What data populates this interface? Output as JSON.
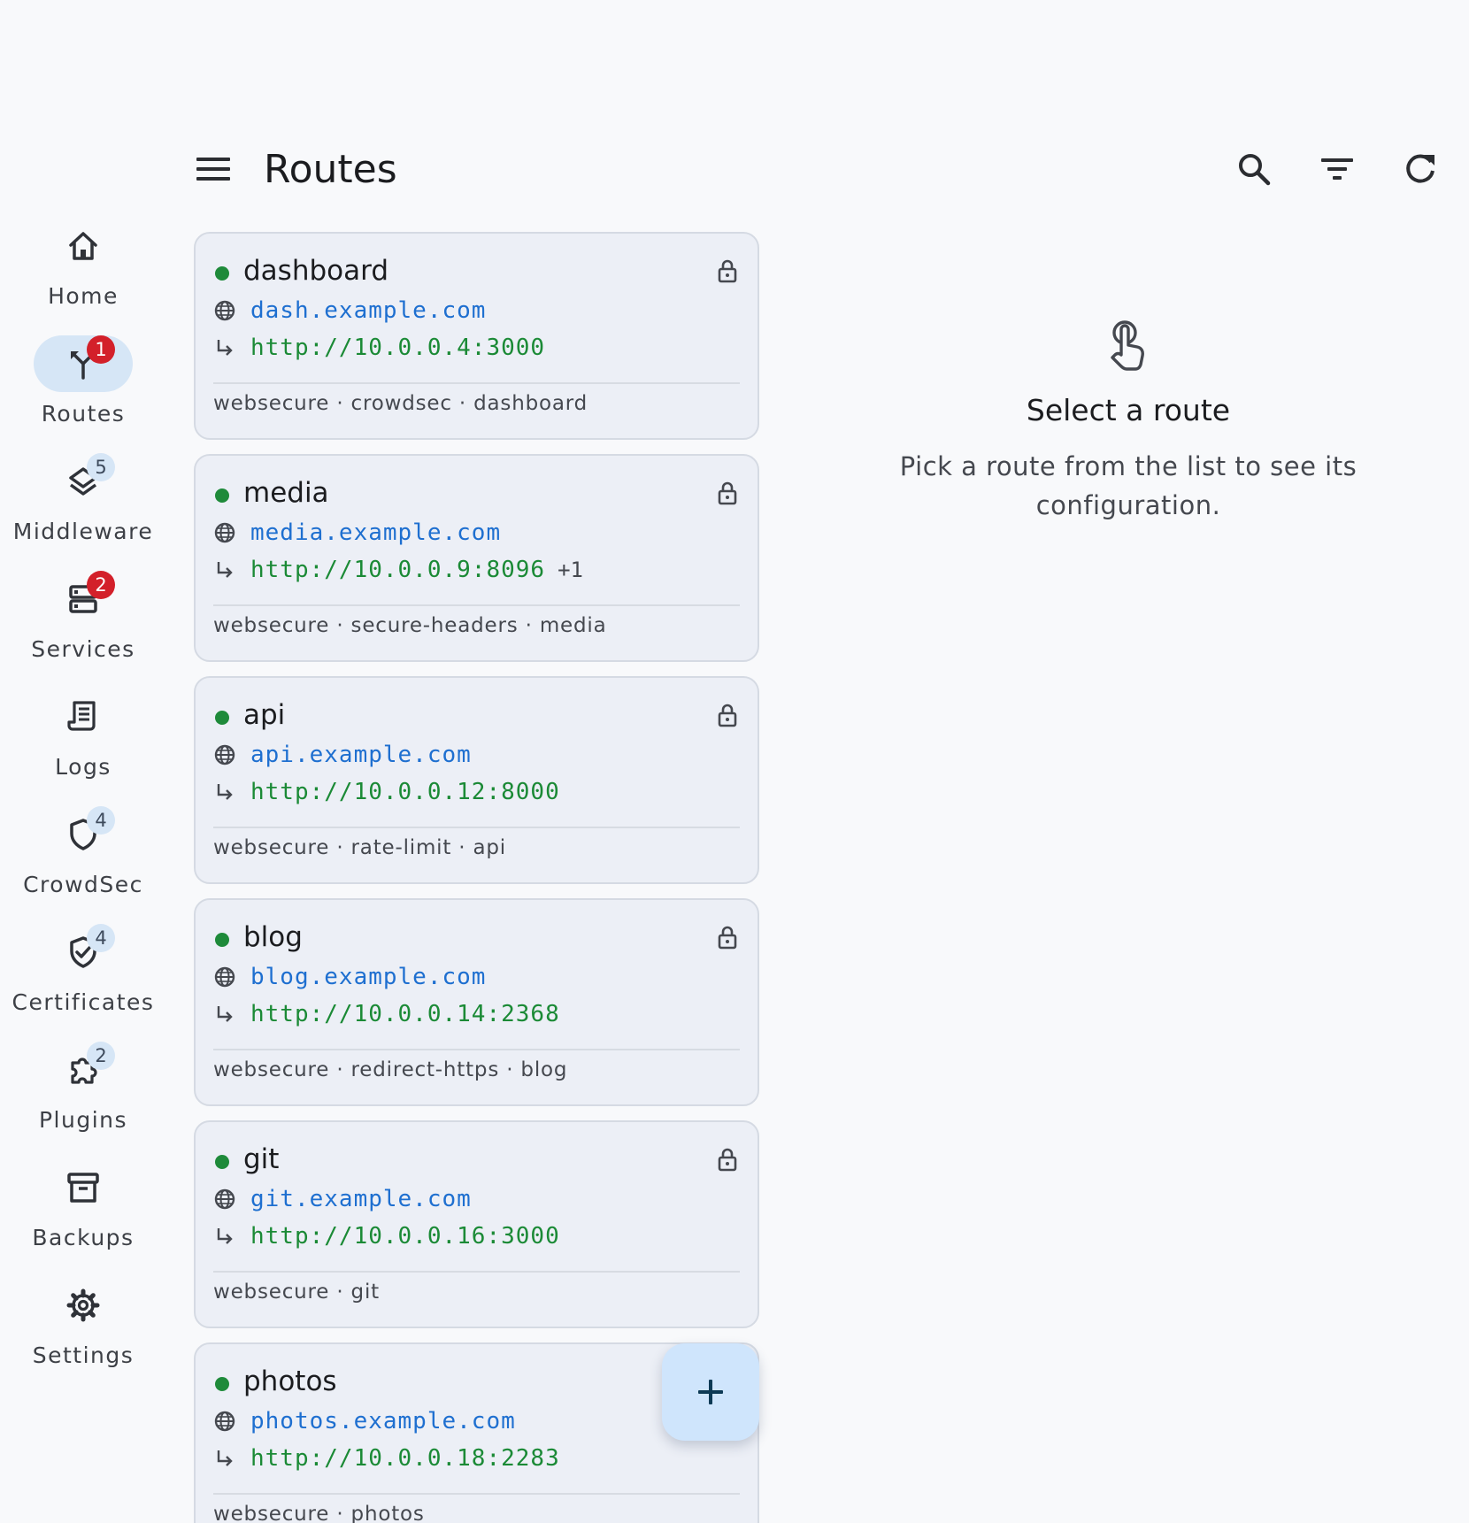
{
  "colors": {
    "background": "#f8f9fb",
    "card": "#eceff6",
    "host": "#1e6fd0",
    "target": "#1b8a36",
    "status_ok": "#1e8a3a",
    "badge_alert": "#d3202a",
    "nav_active": "#d6e6f6",
    "fab": "#cfe5fc"
  },
  "topbar": {
    "title": "Routes",
    "menu_icon": "menu-icon",
    "actions": [
      "search-icon",
      "filter-icon",
      "refresh-icon"
    ]
  },
  "nav": {
    "items": [
      {
        "label": "Home",
        "icon": "home-icon",
        "badge": "",
        "active": false
      },
      {
        "label": "Routes",
        "icon": "routes-icon",
        "badge": "1",
        "active": true
      },
      {
        "label": "Middleware",
        "icon": "layers-icon",
        "badge": "5",
        "active": false
      },
      {
        "label": "Services",
        "icon": "server-icon",
        "badge": "2",
        "active": false
      },
      {
        "label": "Logs",
        "icon": "logs-icon",
        "badge": "",
        "active": false
      },
      {
        "label": "CrowdSec",
        "icon": "shield-icon",
        "badge": "4",
        "active": false
      },
      {
        "label": "Certificates",
        "icon": "certificate-icon",
        "badge": "4",
        "active": false
      },
      {
        "label": "Plugins",
        "icon": "plugin-icon",
        "badge": "2",
        "active": false
      },
      {
        "label": "Backups",
        "icon": "archive-icon",
        "badge": "",
        "active": false
      },
      {
        "label": "Settings",
        "icon": "gear-icon",
        "badge": "",
        "active": false
      }
    ]
  },
  "routes": [
    {
      "name": "dashboard",
      "host": "dash.example.com",
      "target": "http://10.0.0.4:3000",
      "extra": "",
      "chips": "websecure · crowdsec · dashboard",
      "locked": true
    },
    {
      "name": "media",
      "host": "media.example.com",
      "target": "http://10.0.0.9:8096",
      "extra": "+1",
      "chips": "websecure · secure-headers · media",
      "locked": true
    },
    {
      "name": "api",
      "host": "api.example.com",
      "target": "http://10.0.0.12:8000",
      "extra": "",
      "chips": "websecure · rate-limit · api",
      "locked": true
    },
    {
      "name": "blog",
      "host": "blog.example.com",
      "target": "http://10.0.0.14:2368",
      "extra": "",
      "chips": "websecure · redirect-https · blog",
      "locked": true
    },
    {
      "name": "git",
      "host": "git.example.com",
      "target": "http://10.0.0.16:3000",
      "extra": "",
      "chips": "websecure · git",
      "locked": true
    },
    {
      "name": "photos",
      "host": "photos.example.com",
      "target": "http://10.0.0.18:2283",
      "extra": "",
      "chips": "websecure · photos",
      "locked": false
    }
  ],
  "fab": {
    "icon": "add-icon"
  },
  "detail": {
    "icon": "touch-icon",
    "title": "Select a route",
    "subtitle": "Pick a route from the list to see its configuration."
  }
}
